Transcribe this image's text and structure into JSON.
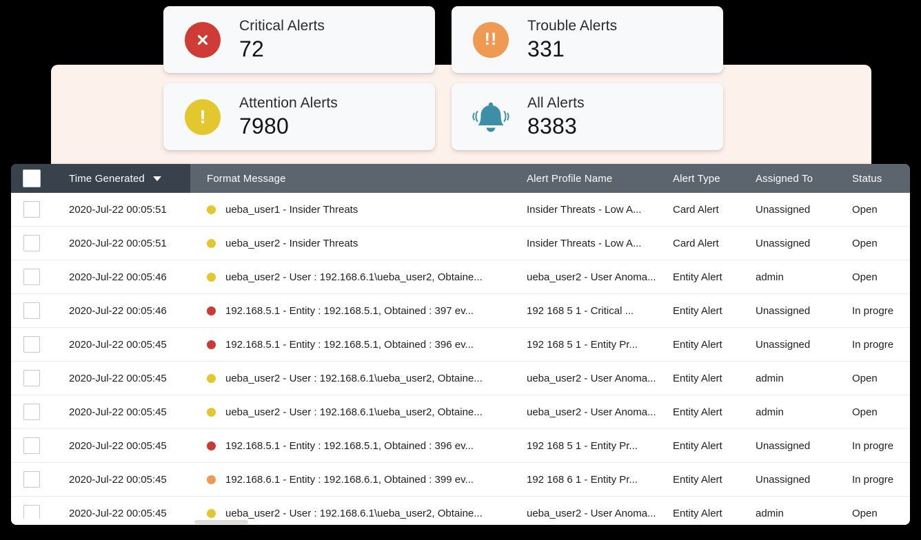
{
  "cards": [
    {
      "id": "critical",
      "title": "Critical Alerts",
      "value": "72",
      "icon": "error-circle-icon",
      "color": "#CF3B35",
      "glyph": "✕"
    },
    {
      "id": "trouble",
      "title": "Trouble Alerts",
      "value": "331",
      "icon": "double-exclamation-circle-icon",
      "color": "#EE9A52",
      "glyph": "!!"
    },
    {
      "id": "attention",
      "title": "Attention Alerts",
      "value": "7980",
      "icon": "exclamation-circle-icon",
      "color": "#E2C72E",
      "glyph": "!"
    },
    {
      "id": "all",
      "title": "All Alerts",
      "value": "8383",
      "icon": "ringing-bell-icon",
      "color": "#3D8FA8",
      "glyph": "bell"
    }
  ],
  "table": {
    "columns": {
      "select": "",
      "time": "Time Generated",
      "message": "Format Message",
      "profile": "Alert Profile Name",
      "type": "Alert Type",
      "assigned": "Assigned To",
      "status": "Status"
    },
    "sort": {
      "column": "Time Generated",
      "direction": "desc"
    },
    "rows": [
      {
        "time": "2020-Jul-22 00:05:51",
        "severity": "low",
        "message": "ueba_user1 - Insider Threats",
        "profile": "Insider Threats - Low A...",
        "type": "Card Alert",
        "assigned": "Unassigned",
        "status": "Open"
      },
      {
        "time": "2020-Jul-22 00:05:51",
        "severity": "low",
        "message": "ueba_user2 - Insider Threats",
        "profile": "Insider Threats - Low A...",
        "type": "Card Alert",
        "assigned": "Unassigned",
        "status": "Open"
      },
      {
        "time": "2020-Jul-22 00:05:46",
        "severity": "low",
        "message": "ueba_user2 - User : 192.168.6.1\\ueba_user2, Obtaine...",
        "profile": "ueba_user2 - User Anoma...",
        "type": "Entity Alert",
        "assigned": "admin",
        "status": "Open"
      },
      {
        "time": "2020-Jul-22 00:05:46",
        "severity": "high",
        "message": "192.168.5.1 - Entity : 192.168.5.1, Obtained : 397 ev...",
        "profile": "192 168 5 1 - Critical ...",
        "type": "Entity Alert",
        "assigned": "Unassigned",
        "status": "In progre"
      },
      {
        "time": "2020-Jul-22 00:05:45",
        "severity": "high",
        "message": "192.168.5.1 - Entity : 192.168.5.1, Obtained : 396 ev...",
        "profile": "192 168 5 1 - Entity Pr...",
        "type": "Entity Alert",
        "assigned": "Unassigned",
        "status": "In progre"
      },
      {
        "time": "2020-Jul-22 00:05:45",
        "severity": "low",
        "message": "ueba_user2 - User : 192.168.6.1\\ueba_user2, Obtaine...",
        "profile": "ueba_user2 - User Anoma...",
        "type": "Entity Alert",
        "assigned": "admin",
        "status": "Open"
      },
      {
        "time": "2020-Jul-22 00:05:45",
        "severity": "low",
        "message": "ueba_user2 - User : 192.168.6.1\\ueba_user2, Obtaine...",
        "profile": "ueba_user2 - User Anoma...",
        "type": "Entity Alert",
        "assigned": "admin",
        "status": "Open"
      },
      {
        "time": "2020-Jul-22 00:05:45",
        "severity": "high",
        "message": "192.168.5.1 - Entity : 192.168.5.1, Obtained : 396 ev...",
        "profile": "192 168 5 1 - Entity Pr...",
        "type": "Entity Alert",
        "assigned": "Unassigned",
        "status": "In progre"
      },
      {
        "time": "2020-Jul-22 00:05:45",
        "severity": "medium",
        "message": "192.168.6.1 - Entity : 192.168.6.1, Obtained : 399 ev...",
        "profile": "192 168 6 1 - Entity Pr...",
        "type": "Entity Alert",
        "assigned": "Unassigned",
        "status": "In progre"
      },
      {
        "time": "2020-Jul-22 00:05:45",
        "severity": "low",
        "message": "ueba_user2 - User : 192.168.6.1\\ueba_user2, Obtaine...",
        "profile": "ueba_user2 - User Anoma...",
        "type": "Entity Alert",
        "assigned": "admin",
        "status": "Open"
      }
    ]
  },
  "theme": {
    "header_bg": "#5C646E",
    "header_active_bg": "#39424C",
    "panel_bg": "#FDF1EC",
    "severity_high": "#CB3A33",
    "severity_medium": "#EE9A52",
    "severity_low": "#E3C72F"
  }
}
